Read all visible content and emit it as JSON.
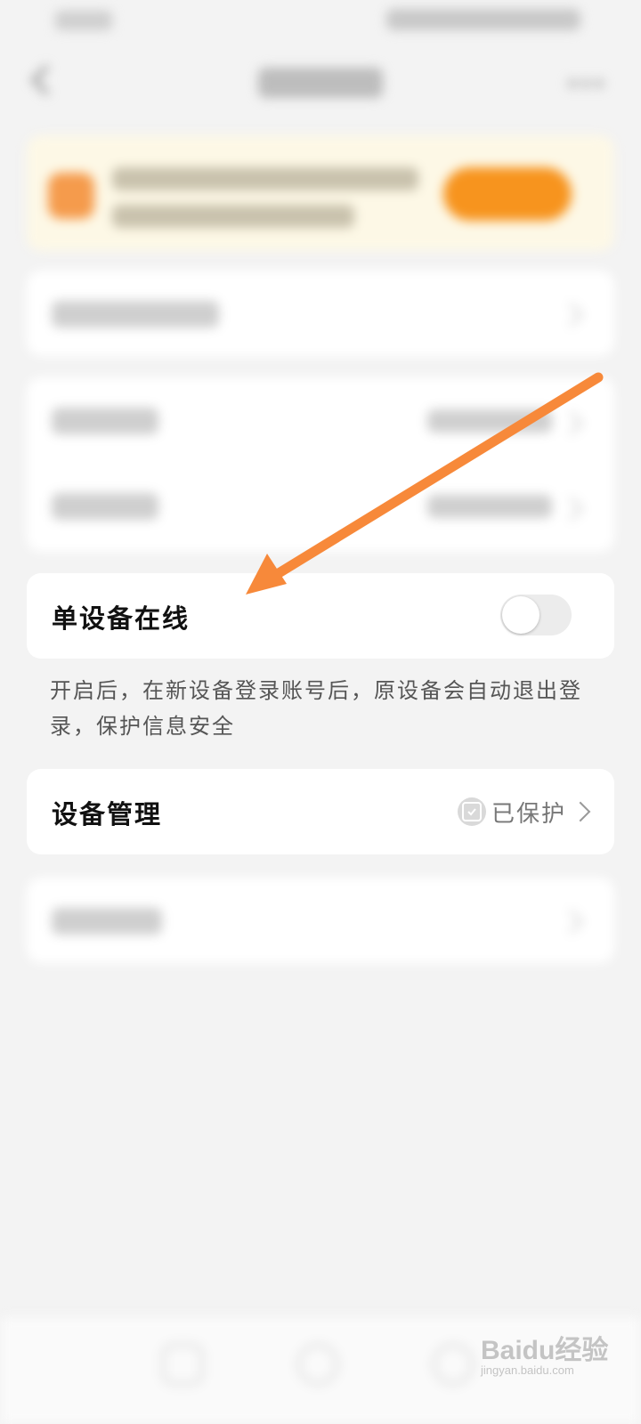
{
  "single_device": {
    "label": "单设备在线",
    "toggle_on": false
  },
  "single_device_description": "开启后，在新设备登录账号后，原设备会自动退出登录，保护信息安全",
  "device_management": {
    "label": "设备管理",
    "status": "已保护"
  },
  "watermark": {
    "brand": "Baidu经验",
    "url": "jingyan.baidu.com"
  },
  "annotation": {
    "arrow_color": "#f7893a"
  }
}
